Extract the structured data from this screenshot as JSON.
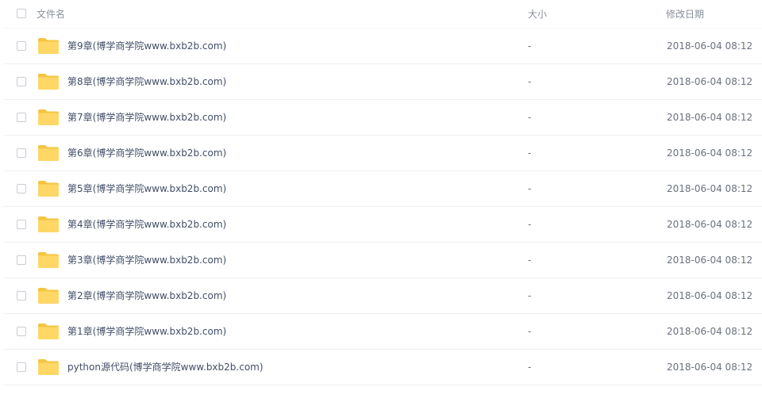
{
  "header": {
    "name_label": "文件名",
    "size_label": "大小",
    "date_label": "修改日期"
  },
  "accent": {
    "folder_color": "#ffd766",
    "folder_tab_color": "#f5c542"
  },
  "icons": {
    "folder": "folder-icon",
    "checkbox": "checkbox"
  },
  "files": [
    {
      "name": "第9章(博学商学院www.bxb2b.com)",
      "size": "-",
      "modified": "2018-06-04 08:12"
    },
    {
      "name": "第8章(博学商学院www.bxb2b.com)",
      "size": "-",
      "modified": "2018-06-04 08:12"
    },
    {
      "name": "第7章(博学商学院www.bxb2b.com)",
      "size": "-",
      "modified": "2018-06-04 08:12"
    },
    {
      "name": "第6章(博学商学院www.bxb2b.com)",
      "size": "-",
      "modified": "2018-06-04 08:12"
    },
    {
      "name": "第5章(博学商学院www.bxb2b.com)",
      "size": "-",
      "modified": "2018-06-04 08:12"
    },
    {
      "name": "第4章(博学商学院www.bxb2b.com)",
      "size": "-",
      "modified": "2018-06-04 08:12"
    },
    {
      "name": "第3章(博学商学院www.bxb2b.com)",
      "size": "-",
      "modified": "2018-06-04 08:12"
    },
    {
      "name": "第2章(博学商学院www.bxb2b.com)",
      "size": "-",
      "modified": "2018-06-04 08:12"
    },
    {
      "name": "第1章(博学商学院www.bxb2b.com)",
      "size": "-",
      "modified": "2018-06-04 08:12"
    },
    {
      "name": "python源代码(博学商学院www.bxb2b.com)",
      "size": "-",
      "modified": "2018-06-04 08:12"
    }
  ]
}
